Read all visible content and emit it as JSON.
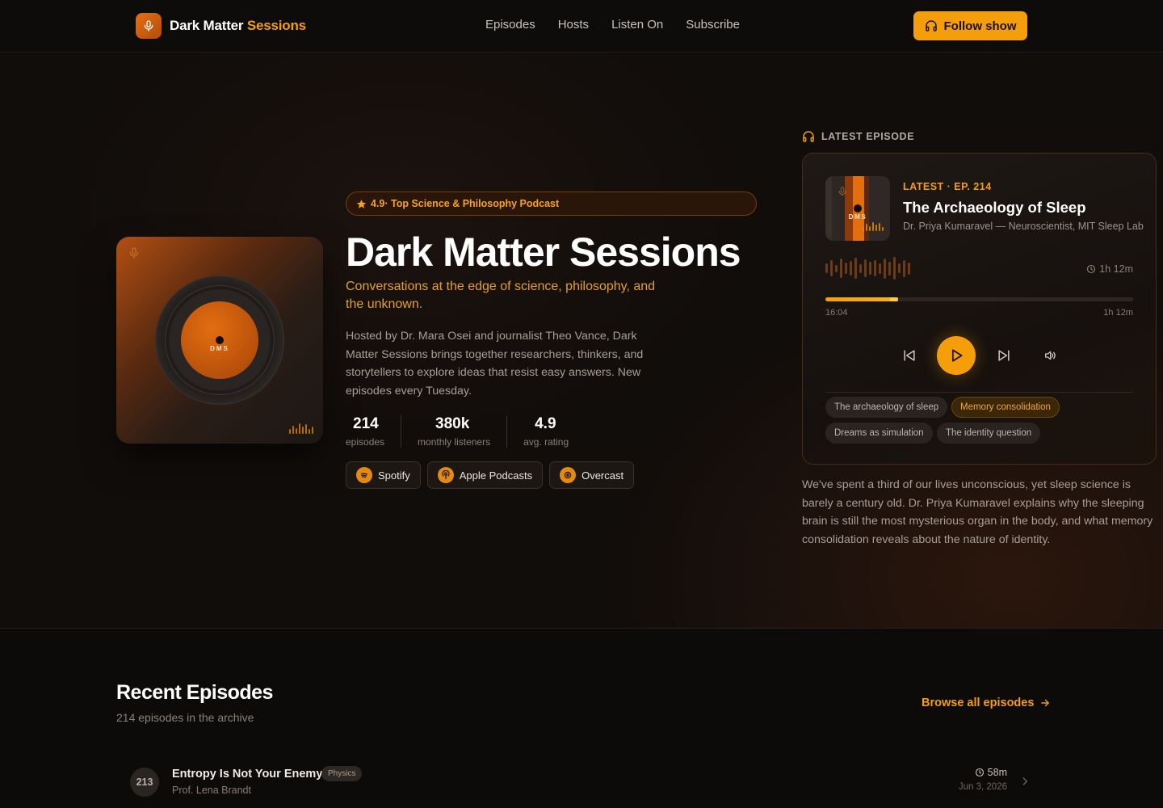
{
  "header": {
    "brand_main": "Dark Matter",
    "brand_accent": "Sessions",
    "nav": [
      "Episodes",
      "Hosts",
      "Listen On",
      "Subscribe"
    ],
    "follow_label": "Follow show"
  },
  "hero": {
    "cover_text": "DMS",
    "badge": "4.9· Top Science & Philosophy Podcast",
    "title": "Dark Matter Sessions",
    "tagline": "Conversations at the edge of science, philosophy, and the unknown.",
    "description": "Hosted by Dr. Mara Osei and journalist Theo Vance, Dark Matter Sessions brings together researchers, thinkers, and storytellers to explore ideas that resist easy answers. New episodes every Tuesday.",
    "stats": [
      {
        "value": "214",
        "label": "episodes"
      },
      {
        "value": "380k",
        "label": "monthly listeners"
      },
      {
        "value": "4.9",
        "label": "avg. rating"
      }
    ],
    "platforms": [
      {
        "label": "Spotify",
        "icon": "spotify-icon"
      },
      {
        "label": "Apple Podcasts",
        "icon": "apple-podcasts-icon"
      },
      {
        "label": "Overcast",
        "icon": "overcast-icon"
      }
    ]
  },
  "latest": {
    "section_label": "LATEST EPISODE",
    "art_text": "DMS",
    "kicker": "LATEST · EP. 214",
    "title": "The Archaeology of Sleep",
    "guest": "Dr. Priya Kumaravel — Neuroscientist, MIT Sleep Lab",
    "duration": "1h 12m",
    "elapsed": "16:04",
    "total": "1h 12m",
    "progress": 0.235,
    "chapters": [
      {
        "label": "The archaeology of sleep",
        "active": false
      },
      {
        "label": "Memory consolidation",
        "active": true
      },
      {
        "label": "Dreams as simulation",
        "active": false
      },
      {
        "label": "The identity question",
        "active": false
      }
    ],
    "description": "We've spent a third of our lives unconscious, yet sleep science is barely a century old. Dr. Priya Kumaravel explains why the sleeping brain is still the most mysterious organ in the body, and what memory consolidation reveals about the nature of identity."
  },
  "recent": {
    "title": "Recent Episodes",
    "subtitle": "214 episodes in the archive",
    "browse_label": "Browse all episodes",
    "episodes": [
      {
        "number": "213",
        "title": "Entropy Is Not Your Enemy",
        "tag": "Physics",
        "host": "Prof. Lena Brandt",
        "duration": "58m",
        "date": "Jun 3, 2026"
      }
    ]
  },
  "colors": {
    "accent": "#f59e0b",
    "background": "#0d0b0a",
    "cover_orange": "#e36e10"
  }
}
